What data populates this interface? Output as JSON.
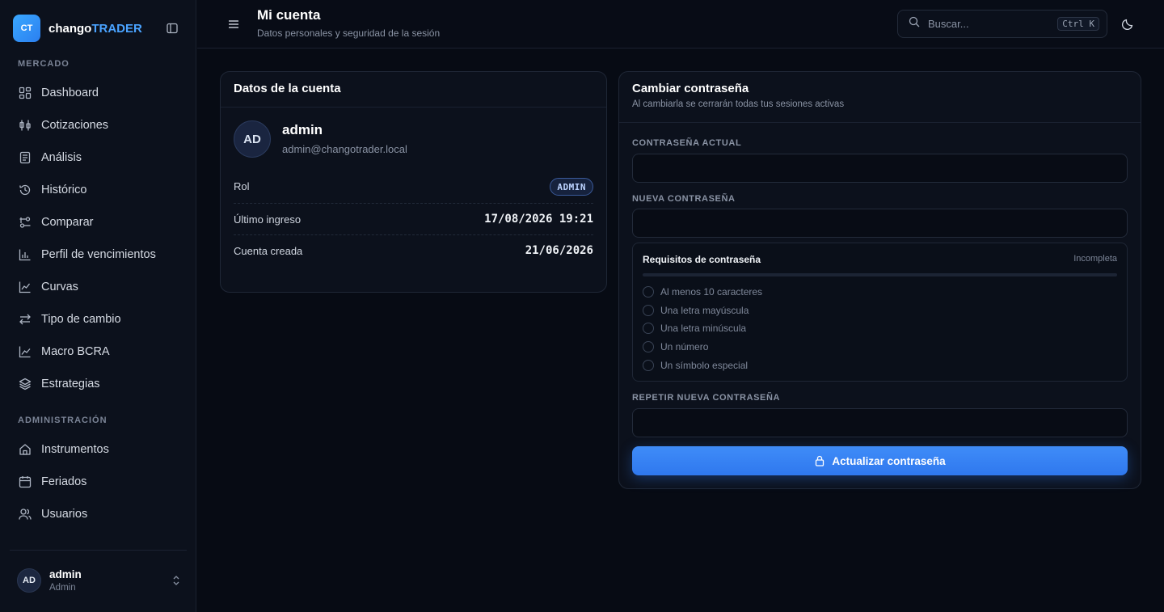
{
  "brand": {
    "logo": "CT",
    "name_part1": "chango",
    "name_part2": "TRADER"
  },
  "sidebar": {
    "section_market": "MERCADO",
    "market_items": [
      {
        "label": "Dashboard",
        "icon": "grid-icon"
      },
      {
        "label": "Cotizaciones",
        "icon": "candlestick-icon"
      },
      {
        "label": "Análisis",
        "icon": "document-icon"
      },
      {
        "label": "Histórico",
        "icon": "history-icon"
      },
      {
        "label": "Comparar",
        "icon": "compare-icon"
      },
      {
        "label": "Perfil de vencimientos",
        "icon": "bar-chart-icon"
      },
      {
        "label": "Curvas",
        "icon": "line-chart-icon"
      },
      {
        "label": "Tipo de cambio",
        "icon": "exchange-icon"
      },
      {
        "label": "Macro BCRA",
        "icon": "trend-icon"
      },
      {
        "label": "Estrategias",
        "icon": "layers-icon"
      }
    ],
    "section_admin": "ADMINISTRACIÓN",
    "admin_items": [
      {
        "label": "Instrumentos",
        "icon": "home-icon"
      },
      {
        "label": "Feriados",
        "icon": "calendar-icon"
      },
      {
        "label": "Usuarios",
        "icon": "users-icon"
      }
    ],
    "user": {
      "initials": "AD",
      "name": "admin",
      "role": "Admin"
    }
  },
  "header": {
    "title": "Mi cuenta",
    "subtitle": "Datos personales y seguridad de la sesión",
    "search_placeholder": "Buscar...",
    "search_shortcut": "Ctrl K"
  },
  "account": {
    "title": "Datos de la cuenta",
    "initials": "AD",
    "username": "admin",
    "email": "admin@changotrader.local",
    "role_label": "Rol",
    "role_value": "ADMIN",
    "last_login_label": "Último ingreso",
    "last_login_value": "17/08/2026 19:21",
    "created_label": "Cuenta creada",
    "created_value": "21/06/2026"
  },
  "password": {
    "title": "Cambiar contraseña",
    "subtitle": "Al cambiarla se cerrarán todas tus sesiones activas",
    "current_label": "CONTRASEÑA ACTUAL",
    "new_label": "NUEVA CONTRASEÑA",
    "repeat_label": "REPETIR NUEVA CONTRASEÑA",
    "current_value": "",
    "new_value": "",
    "repeat_value": "",
    "requirements_title": "Requisitos de contraseña",
    "requirements_status": "Incompleta",
    "requirements_progress": 0,
    "requirements": [
      "Al menos 10 caracteres",
      "Una letra mayúscula",
      "Una letra minúscula",
      "Un número",
      "Un símbolo especial"
    ],
    "submit_label": "Actualizar contraseña"
  },
  "colors": {
    "accent": "#2f78ee",
    "brand": "#3aa8ff",
    "background": "#070b14"
  }
}
